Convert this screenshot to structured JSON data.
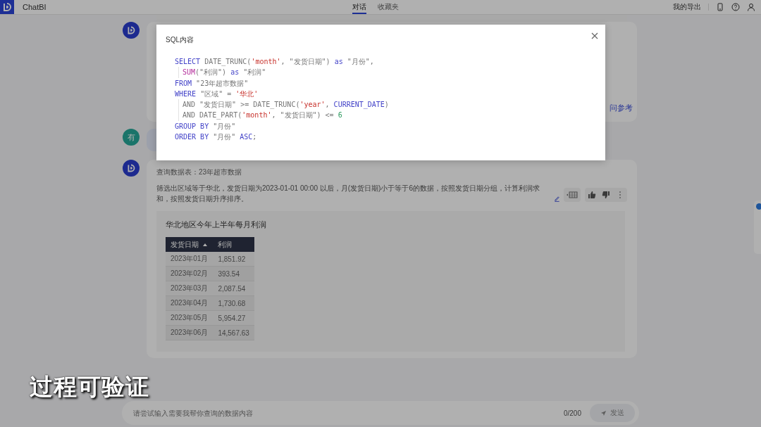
{
  "topbar": {
    "app_name": "ChatBI",
    "tabs": [
      {
        "label": "对话",
        "selected": true
      },
      {
        "label": "收藏夹",
        "selected": false
      }
    ],
    "export_link": "我的导出"
  },
  "messages": [
    {
      "kind": "tail"
    },
    {
      "kind": "bot",
      "link": "问参考"
    },
    {
      "kind": "user",
      "avatar": "有"
    },
    {
      "kind": "answer",
      "source": "查询数据表：23年超市数据",
      "description": "筛选出区域等于华北，发货日期为2023-01-01 00:00 以后，月(发货日期)小于等于6的数据，按照发货日期分组，计算利润求和，按照发货日期升序排序。",
      "chart_title": "华北地区今年上半年每月利润",
      "table": {
        "columns": [
          {
            "label": "发货日期",
            "sorted": true
          },
          {
            "label": "利润",
            "sorted": false
          }
        ],
        "rows": [
          [
            "2023年01月",
            "1,851.92"
          ],
          [
            "2023年02月",
            "393.54"
          ],
          [
            "2023年03月",
            "2,087.54"
          ],
          [
            "2023年04月",
            "1,730.68"
          ],
          [
            "2023年05月",
            "5,954.27"
          ],
          [
            "2023年06月",
            "14,567.63"
          ]
        ]
      }
    }
  ],
  "input": {
    "placeholder": "请尝试输入需要我帮你查询的数据内容",
    "counter": "0/200",
    "send": "发送"
  },
  "caption": "过程可验证",
  "modal": {
    "title": "SQL内容",
    "lines": [
      {
        "indented": false,
        "tokens": [
          {
            "kind": "keyword",
            "text": "SELECT"
          },
          {
            "kind": "plain",
            "text": " DATE_TRUNC("
          },
          {
            "kind": "string",
            "text": "'month'"
          },
          {
            "kind": "plain",
            "text": ", \"发货日期\") "
          },
          {
            "kind": "keyword",
            "text": "as"
          },
          {
            "kind": "plain",
            "text": " \"月份\","
          }
        ]
      },
      {
        "indented": true,
        "tokens": [
          {
            "kind": "function",
            "text": "SUM"
          },
          {
            "kind": "plain",
            "text": "(\"利润\") "
          },
          {
            "kind": "keyword",
            "text": "as"
          },
          {
            "kind": "plain",
            "text": " \"利润\""
          }
        ]
      },
      {
        "indented": false,
        "tokens": [
          {
            "kind": "keyword",
            "text": "FROM"
          },
          {
            "kind": "plain",
            "text": " \"23年超市数据\""
          }
        ]
      },
      {
        "indented": false,
        "tokens": [
          {
            "kind": "keyword",
            "text": "WHERE"
          },
          {
            "kind": "plain",
            "text": " \"区域\" = "
          },
          {
            "kind": "string",
            "text": "'华北'"
          }
        ]
      },
      {
        "indented": true,
        "tokens": [
          {
            "kind": "plain",
            "text": "AND \"发货日期\" >= DATE_TRUNC("
          },
          {
            "kind": "string",
            "text": "'year'"
          },
          {
            "kind": "plain",
            "text": ", "
          },
          {
            "kind": "keyword",
            "text": "CURRENT_DATE"
          },
          {
            "kind": "plain",
            "text": ")"
          }
        ]
      },
      {
        "indented": true,
        "tokens": [
          {
            "kind": "plain",
            "text": "AND DATE_PART("
          },
          {
            "kind": "string",
            "text": "'month'"
          },
          {
            "kind": "plain",
            "text": ", \"发货日期\") <= "
          },
          {
            "kind": "number",
            "text": "6"
          }
        ]
      },
      {
        "indented": false,
        "tokens": [
          {
            "kind": "keyword",
            "text": "GROUP BY"
          },
          {
            "kind": "plain",
            "text": " \"月份\""
          }
        ]
      },
      {
        "indented": false,
        "tokens": [
          {
            "kind": "keyword",
            "text": "ORDER BY"
          },
          {
            "kind": "plain",
            "text": " \"月份\" "
          },
          {
            "kind": "keyword",
            "text": "ASC"
          },
          {
            "kind": "plain",
            "text": ";"
          }
        ]
      }
    ]
  }
}
